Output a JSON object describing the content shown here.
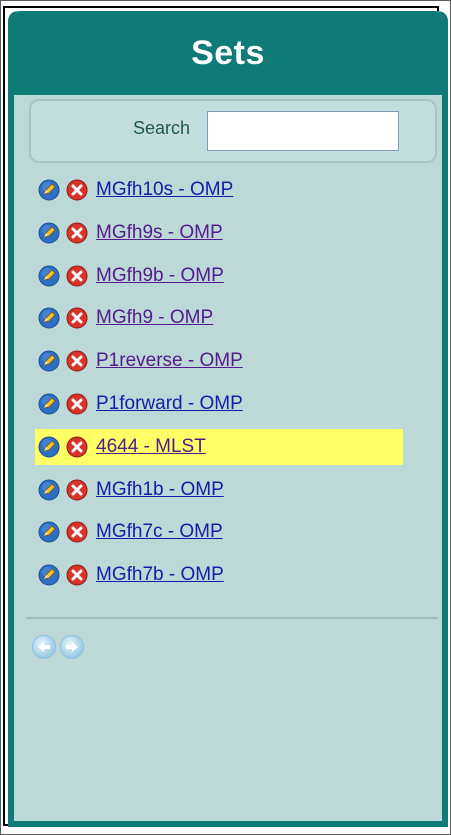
{
  "header": {
    "title": "Sets"
  },
  "search": {
    "label": "Search",
    "value": "",
    "placeholder": ""
  },
  "sets": [
    {
      "label": "MGfh10s - OMP",
      "visited": false,
      "highlighted": false
    },
    {
      "label": "MGfh9s - OMP",
      "visited": true,
      "highlighted": false
    },
    {
      "label": "MGfh9b - OMP",
      "visited": true,
      "highlighted": false
    },
    {
      "label": "MGfh9 - OMP",
      "visited": true,
      "highlighted": false
    },
    {
      "label": "P1reverse - OMP",
      "visited": true,
      "highlighted": false
    },
    {
      "label": "P1forward - OMP",
      "visited": false,
      "highlighted": false
    },
    {
      "label": "4644 - MLST",
      "visited": true,
      "highlighted": true
    },
    {
      "label": "MGfh1b - OMP",
      "visited": false,
      "highlighted": false
    },
    {
      "label": "MGfh7c - OMP",
      "visited": false,
      "highlighted": false
    },
    {
      "label": "MGfh7b - OMP",
      "visited": false,
      "highlighted": false
    }
  ],
  "icons": {
    "edit": "pencil-edit-icon",
    "delete": "delete-x-icon",
    "previous": "arrow-left-icon",
    "next": "arrow-right-icon"
  },
  "colors": {
    "header_bg": "#0e7b76",
    "panel_bg": "#bcd9d8",
    "highlight": "#ffff66",
    "link": "#1a1aa6",
    "link_visited": "#551a8b"
  }
}
